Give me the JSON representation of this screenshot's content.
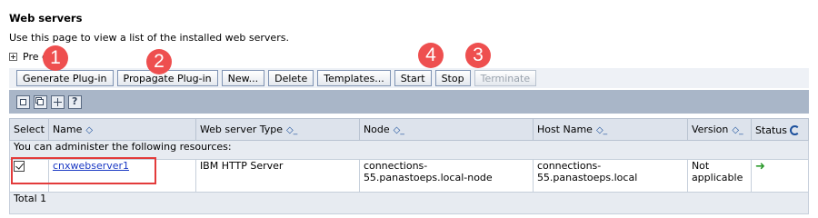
{
  "page": {
    "title": "Web servers",
    "description": "Use this page to view a list of the installed web servers.",
    "preferences_label": "Pre ces"
  },
  "toolbar": {
    "buttons": [
      {
        "label": "Generate Plug-in",
        "enabled": true
      },
      {
        "label": "Propagate Plug-in",
        "enabled": true
      },
      {
        "label": "New...",
        "enabled": true
      },
      {
        "label": "Delete",
        "enabled": true
      },
      {
        "label": "Templates...",
        "enabled": true
      },
      {
        "label": "Start",
        "enabled": true
      },
      {
        "label": "Stop",
        "enabled": true
      },
      {
        "label": "Terminate",
        "enabled": false
      }
    ]
  },
  "icon_toolbar": [
    "select-all-icon",
    "deselect-all-icon",
    "show-filter-icon",
    "clear-filter-icon"
  ],
  "table": {
    "columns": [
      "Select",
      "Name",
      "Web server Type",
      "Node",
      "Host Name",
      "Version",
      "Status"
    ],
    "resources_message": "You can administer the following resources:",
    "rows": [
      {
        "selected": true,
        "name": "cnxwebserver1",
        "type": "IBM HTTP Server",
        "node": "connections-55.panastoeps.local-node",
        "host": "connections-55.panastoeps.local",
        "version": "Not applicable",
        "status": "started-arrow-icon"
      }
    ],
    "total_label": "Total 1"
  },
  "annotations": {
    "badges": [
      "1",
      "2",
      "3",
      "4"
    ],
    "color": "#ee4f4f"
  }
}
